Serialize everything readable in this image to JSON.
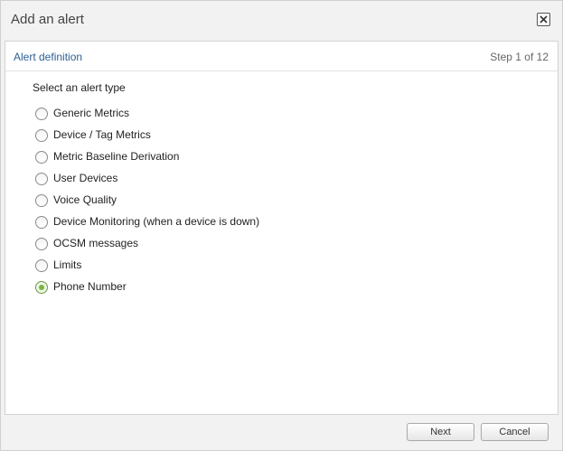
{
  "dialog": {
    "title": "Add an alert",
    "close_icon": "close-icon"
  },
  "panel": {
    "title": "Alert definition",
    "step": "Step 1 of 12",
    "prompt": "Select an alert type",
    "options": [
      {
        "label": "Generic Metrics",
        "checked": false
      },
      {
        "label": "Device / Tag Metrics",
        "checked": false
      },
      {
        "label": "Metric Baseline Derivation",
        "checked": false
      },
      {
        "label": "User Devices",
        "checked": false
      },
      {
        "label": "Voice Quality",
        "checked": false
      },
      {
        "label": "Device Monitoring (when a device is down)",
        "checked": false
      },
      {
        "label": "OCSM messages",
        "checked": false
      },
      {
        "label": "Limits",
        "checked": false
      },
      {
        "label": "Phone Number",
        "checked": true
      }
    ]
  },
  "footer": {
    "next_label": "Next",
    "cancel_label": "Cancel"
  },
  "colors": {
    "panel_title": "#2b5f95",
    "radio_checked": "#7cb342",
    "dialog_bg": "#f2f2f2"
  }
}
